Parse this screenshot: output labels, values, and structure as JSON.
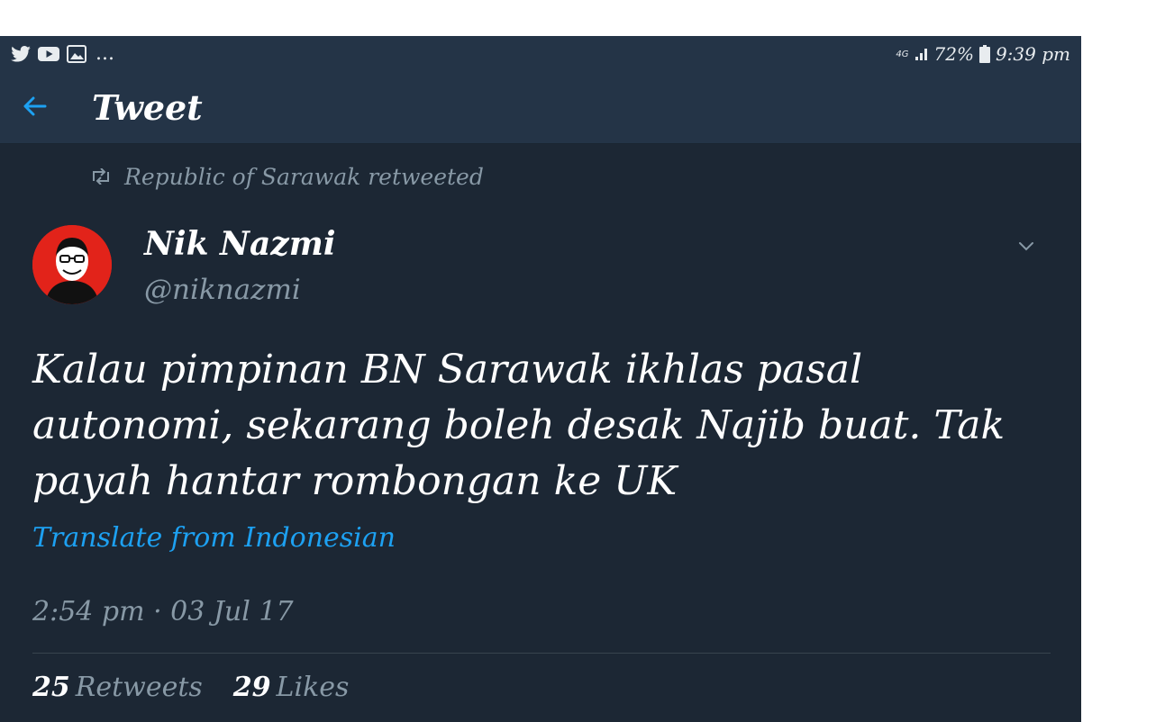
{
  "status_bar": {
    "notification_icons": [
      "twitter-icon",
      "youtube-icon",
      "image-icon"
    ],
    "overflow": "...",
    "network": "4G",
    "battery": "72%",
    "time": "9:39 pm"
  },
  "header": {
    "title": "Tweet"
  },
  "tweet": {
    "retweeted_by": "Republic of Sarawak retweeted",
    "author_name": "Nik Nazmi",
    "author_handle": "@niknazmi",
    "text": "Kalau pimpinan BN Sarawak ikhlas pasal autonomi, sekarang boleh desak Najib buat. Tak payah hantar rombongan ke UK",
    "translate_label": "Translate from Indonesian",
    "timestamp": "2:54 pm · 03 Jul 17",
    "retweets_count": "25",
    "retweets_label": "Retweets",
    "likes_count": "29",
    "likes_label": "Likes"
  },
  "colors": {
    "background": "#1c2734",
    "header": "#243447",
    "accent": "#1da1f2",
    "muted": "#8899a6",
    "avatar_bg": "#e2231a"
  }
}
